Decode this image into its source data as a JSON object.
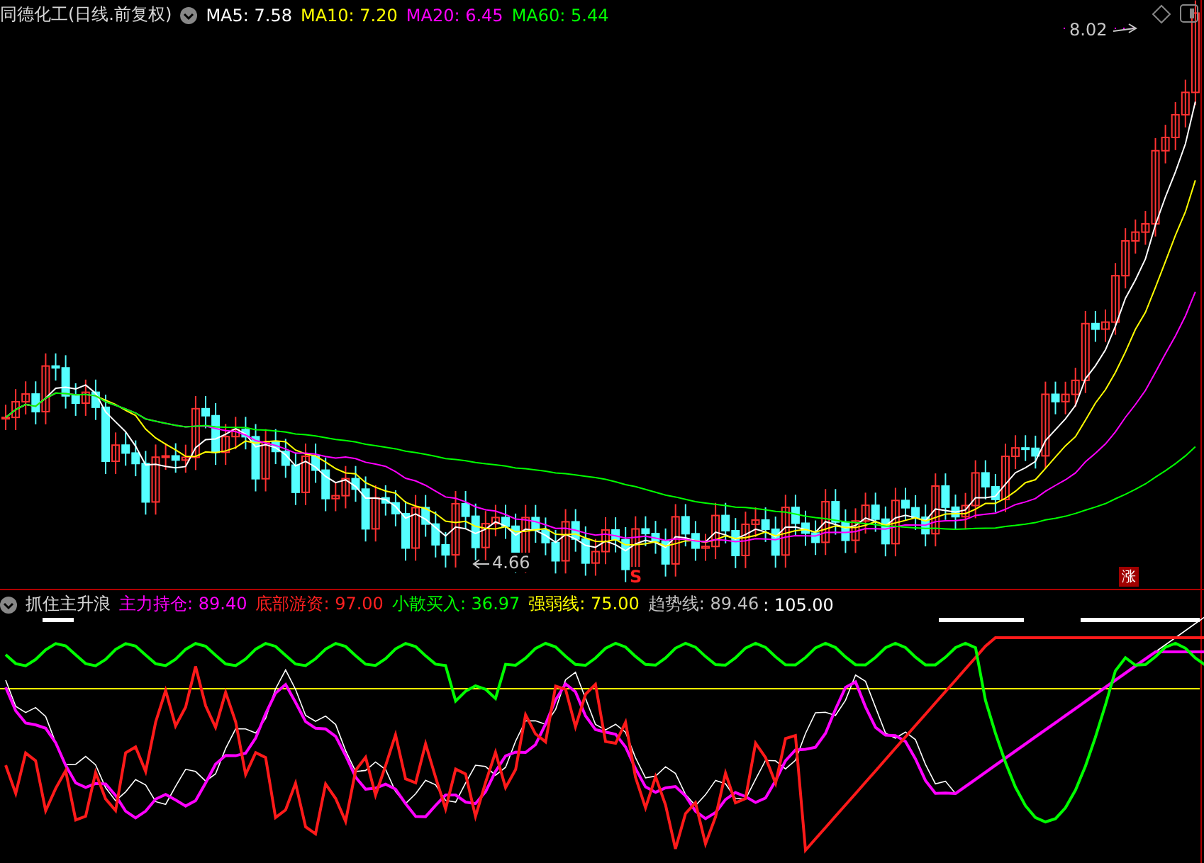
{
  "main_chart": {
    "title": "同德化工(日线.前复权)",
    "ma_legend": [
      {
        "label": "MA5: 7.58",
        "color": "#ffffff"
      },
      {
        "label": "MA10: 7.20",
        "color": "#ffff00"
      },
      {
        "label": "MA20: 6.45",
        "color": "#ff00ff"
      },
      {
        "label": "MA60: 5.44",
        "color": "#00ff00"
      }
    ],
    "high_label": "8.02",
    "low_label": "4.66",
    "sell_signal": "S",
    "rise_signal": "涨"
  },
  "indicator": {
    "name": "抓住主升浪",
    "values": [
      {
        "label": "主力持仓: 89.40",
        "color": "#ff00ff"
      },
      {
        "label": "底部游资: 97.00",
        "color": "#ff2020"
      },
      {
        "label": "小散买入: 36.97",
        "color": "#00ff00"
      },
      {
        "label": "强弱线: 75.00",
        "color": "#ffff00"
      },
      {
        "label": "趋势线: 89.46",
        "color": "#c0c0c0"
      },
      {
        "label": ": 105.00",
        "color": "#ffffff"
      }
    ]
  }
}
